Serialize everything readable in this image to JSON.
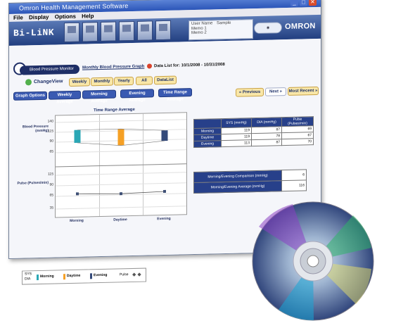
{
  "window": {
    "title": "Omron Health Management Software",
    "menu": [
      "File",
      "Display",
      "Options",
      "Help"
    ],
    "logo": "Bi-LiNK",
    "user_box": {
      "name_label": "User Name",
      "name_value": "Sample",
      "line2": "Memo 1",
      "line3": "Memo 2"
    },
    "brand": "OMRON"
  },
  "nav": {
    "user_tab": "Blood Pressure Monitor",
    "chart_tab": "Monthly Blood Pressure Graph",
    "data_list_range": "Data List for: 10/1/2008 - 10/31/2008",
    "change_view_label": "ChangeView",
    "view_buttons": [
      "Weekly",
      "Monthly",
      "Yearly",
      "All",
      "DataList"
    ],
    "option_buttons": [
      "Graph Options",
      "Weekly Average",
      "Morning Average",
      "Evening Average",
      "Time Range Average"
    ],
    "paging": [
      "« Previous",
      "Next »",
      "Most Recent »"
    ]
  },
  "chart_data": {
    "type": "bar",
    "title": "Time Range Average",
    "categories": [
      "Morning",
      "Daytime",
      "Evening"
    ],
    "panels": [
      {
        "ylabel": "Blood Pressure (mmHg)",
        "yticks": [
          140,
          115,
          90,
          65
        ],
        "ylim": [
          40,
          145
        ],
        "series": [
          {
            "name": "SYS",
            "values": [
              119,
              119,
              113
            ]
          },
          {
            "name": "DIA",
            "values": [
              87,
              78,
              87
            ]
          }
        ],
        "colors": [
          "#2aa7b5",
          "#f5a025",
          "#344a7a"
        ]
      },
      {
        "ylabel": "Pulse (Pulses/min)",
        "yticks": [
          115,
          90,
          65,
          35
        ],
        "ylim": [
          25,
          125
        ],
        "type": "line",
        "series": [
          {
            "name": "Pulse",
            "values": [
              69,
              67,
              70
            ]
          }
        ]
      }
    ]
  },
  "stats_table": {
    "headers": [
      "SYS (mmHg)",
      "DIA (mmHg)",
      "Pulse (Pulses/min)"
    ],
    "rows": [
      {
        "label": "Morning",
        "values": [
          "119",
          "87",
          "69"
        ]
      },
      {
        "label": "Daytime",
        "values": [
          "119",
          "78",
          "67"
        ]
      },
      {
        "label": "Evening",
        "values": [
          "113",
          "87",
          "70"
        ]
      }
    ]
  },
  "summary_table": {
    "rows": [
      {
        "label": "Morning/Evening Comparison (mmHg)",
        "value": "6"
      },
      {
        "label": "Morning/Evening Average (mmHg)",
        "value": "116"
      }
    ]
  },
  "legend": {
    "items": [
      "SYS",
      "DIA",
      "Morning",
      "Daytime",
      "Evening",
      "Pulse"
    ]
  },
  "colors": {
    "window_blue": "#2b55b8",
    "accent_navy": "#27408a",
    "gold": "#f5c542"
  }
}
